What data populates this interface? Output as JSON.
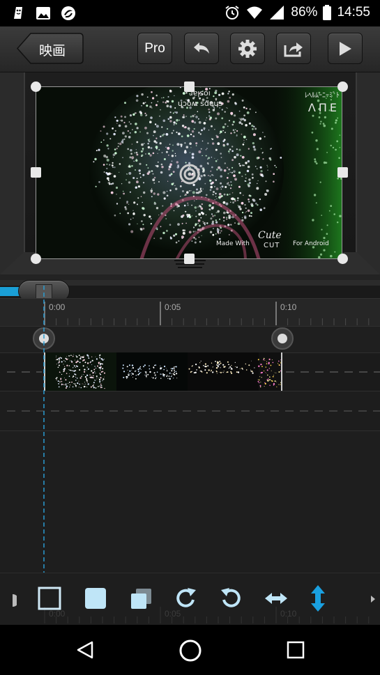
{
  "status_bar": {
    "battery": "86%",
    "time": "14:55",
    "icons": [
      "notification-app-icon",
      "image-icon",
      "sync-app-icon",
      "alarm-icon",
      "wifi-icon",
      "signal-icon",
      "battery-icon"
    ]
  },
  "toolbar": {
    "back_label": "映画",
    "pro_label": "Pro",
    "icons": [
      "undo-icon",
      "gear-icon",
      "share-icon",
      "play-icon"
    ]
  },
  "video_overlay": {
    "top_text_1": "ɹɐןsoı",
    "top_text_2": "ɥɔoʍ sdɐɥs",
    "top_right_1": "ﾚﾍﾙﾑｰﾆｰﾐﾞﾄ",
    "top_right_2": "ΛΠΕ",
    "watermark_left": "Made With",
    "watermark_logo": "Cute",
    "watermark_sub": "CUT",
    "watermark_right": "For Android"
  },
  "timeline": {
    "progress": 0.06,
    "ruler_labels": [
      "0:00",
      "0:05",
      "0:10"
    ],
    "bottom_ruler_labels": [
      "0:00",
      "0:05",
      "0:10"
    ]
  },
  "tools": {
    "icons": [
      "outline-square-icon",
      "filled-square-icon",
      "layers-icon",
      "rotate-right-icon",
      "rotate-left-icon",
      "flip-horizontal-icon",
      "flip-vertical-icon"
    ]
  },
  "nav": {
    "icons": [
      "back-triangle-icon",
      "home-circle-icon",
      "recents-square-icon"
    ]
  }
}
